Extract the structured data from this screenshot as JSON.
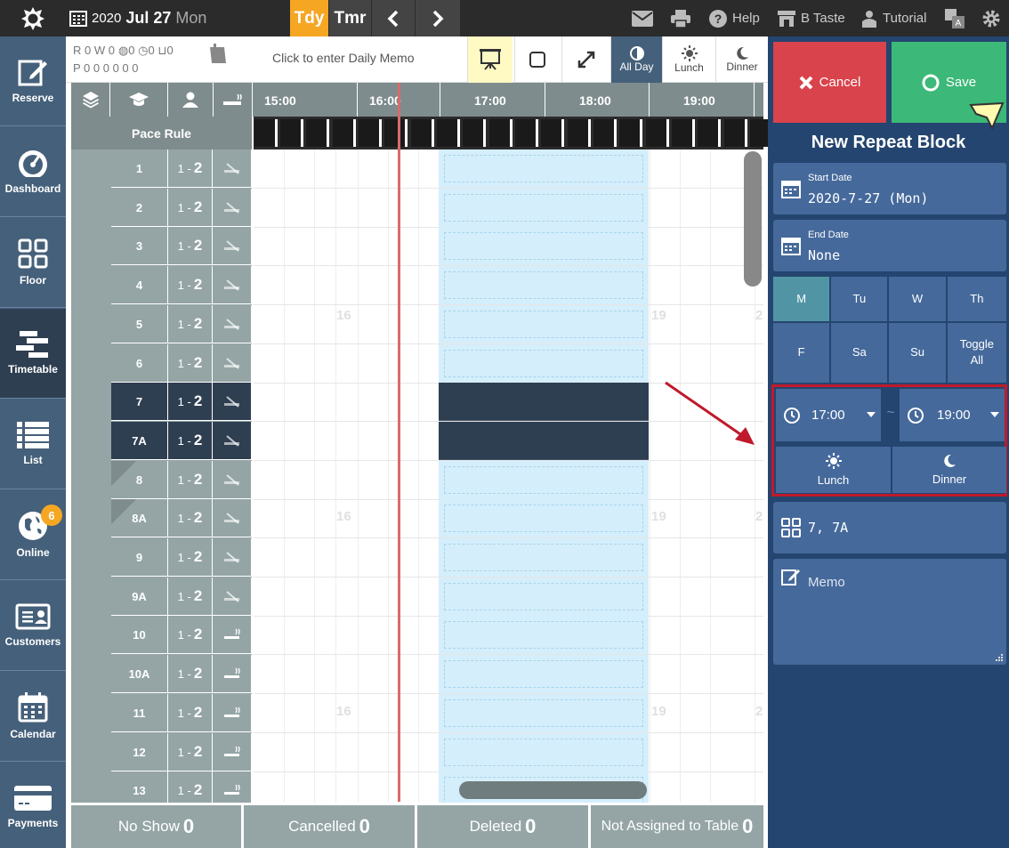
{
  "topbar": {
    "year": "2020",
    "month_day": "Jul 27",
    "weekday": "Mon",
    "today_label": "Tdy",
    "tomorrow_label": "Tmr",
    "help_label": "Help",
    "store_label": "B Taste",
    "tutorial_label": "Tutorial"
  },
  "sidebar": {
    "items": [
      {
        "label": "Reserve",
        "icon": "edit-icon"
      },
      {
        "label": "Dashboard",
        "icon": "gauge-icon"
      },
      {
        "label": "Floor",
        "icon": "grid-icon"
      },
      {
        "label": "Timetable",
        "icon": "timetable-icon"
      },
      {
        "label": "List",
        "icon": "list-icon"
      },
      {
        "label": "Online",
        "icon": "globe-icon",
        "badge": "6"
      },
      {
        "label": "Customers",
        "icon": "id-card-icon"
      },
      {
        "label": "Calendar",
        "icon": "calendar-icon"
      },
      {
        "label": "Payments",
        "icon": "credit-card-icon"
      }
    ]
  },
  "toolbar": {
    "counter_r": "R 0  W 0",
    "counter_r_vals": [
      "0",
      "0",
      "0",
      "0"
    ],
    "counter_p": "P 0   0   0   0   0   0",
    "daily_memo": "Click to enter Daily Memo",
    "all_day": "All Day",
    "lunch": "Lunch",
    "dinner": "Dinner"
  },
  "grid": {
    "times": [
      "15:00",
      "16:00",
      "17:00",
      "18:00",
      "19:00"
    ],
    "pace_rule": "Pace Rule",
    "bg_numbers": [
      "16",
      "19",
      "2"
    ],
    "tables": [
      {
        "name": "1",
        "cap_min": "1 -",
        "cap_max": "2",
        "smoke": false,
        "blocked": false
      },
      {
        "name": "2",
        "cap_min": "1 -",
        "cap_max": "2",
        "smoke": false,
        "blocked": false
      },
      {
        "name": "3",
        "cap_min": "1 -",
        "cap_max": "2",
        "smoke": false,
        "blocked": false
      },
      {
        "name": "4",
        "cap_min": "1 -",
        "cap_max": "2",
        "smoke": false,
        "blocked": false
      },
      {
        "name": "5",
        "cap_min": "1 -",
        "cap_max": "2",
        "smoke": false,
        "blocked": false
      },
      {
        "name": "6",
        "cap_min": "1 -",
        "cap_max": "2",
        "smoke": false,
        "blocked": false
      },
      {
        "name": "7",
        "cap_min": "1 -",
        "cap_max": "2",
        "smoke": false,
        "blocked": true
      },
      {
        "name": "7A",
        "cap_min": "1 -",
        "cap_max": "2",
        "smoke": false,
        "blocked": true
      },
      {
        "name": "8",
        "cap_min": "1 -",
        "cap_max": "2",
        "smoke": false,
        "blocked": false
      },
      {
        "name": "8A",
        "cap_min": "1 -",
        "cap_max": "2",
        "smoke": false,
        "blocked": false
      },
      {
        "name": "9",
        "cap_min": "1 -",
        "cap_max": "2",
        "smoke": false,
        "blocked": false
      },
      {
        "name": "9A",
        "cap_min": "1 -",
        "cap_max": "2",
        "smoke": false,
        "blocked": false
      },
      {
        "name": "10",
        "cap_min": "1 -",
        "cap_max": "2",
        "smoke": true,
        "blocked": false
      },
      {
        "name": "10A",
        "cap_min": "1 -",
        "cap_max": "2",
        "smoke": true,
        "blocked": false
      },
      {
        "name": "11",
        "cap_min": "1 -",
        "cap_max": "2",
        "smoke": true,
        "blocked": false
      },
      {
        "name": "12",
        "cap_min": "1 -",
        "cap_max": "2",
        "smoke": true,
        "blocked": false
      },
      {
        "name": "13",
        "cap_min": "1 -",
        "cap_max": "2",
        "smoke": true,
        "blocked": false
      }
    ]
  },
  "footer": {
    "no_show_label": "No Show",
    "no_show_count": "0",
    "cancelled_label": "Cancelled",
    "cancelled_count": "0",
    "deleted_label": "Deleted",
    "deleted_count": "0",
    "unassigned_label": "Not Assigned to Table",
    "unassigned_count": "0"
  },
  "panel": {
    "cancel_label": "Cancel",
    "save_label": "Save",
    "title": "New Repeat Block",
    "start_date_label": "Start Date",
    "start_date_value": "2020-7-27 (Mon)",
    "end_date_label": "End Date",
    "end_date_value": "None",
    "days": [
      "M",
      "Tu",
      "W",
      "Th",
      "F",
      "Sa",
      "Su",
      "Toggle All"
    ],
    "selected_day": "M",
    "start_time": "17:00",
    "end_time": "19:00",
    "tilde": "~",
    "lunch_label": "Lunch",
    "dinner_label": "Dinner",
    "tables_value": "7, 7A",
    "memo_placeholder": "Memo"
  },
  "colors": {
    "accent_orange": "#f5a623",
    "panel_blue": "#24456f",
    "card_blue": "#45699b",
    "save_green": "#3cb878",
    "cancel_red": "#d9434c",
    "highlight_red": "#c0192b",
    "block_light": "#d5eefb",
    "block_dark": "#2f3f52"
  }
}
